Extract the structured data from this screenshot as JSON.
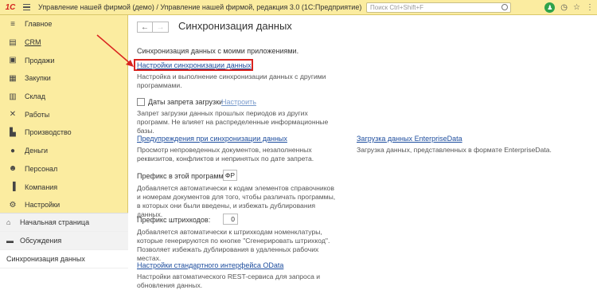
{
  "titlebar": {
    "logo": "1С",
    "title": "Управление нашей фирмой (демо) / Управление нашей фирмой, редакция 3.0  (1С:Предприятие)",
    "search_placeholder": "Поиск Ctrl+Shift+F"
  },
  "sidebar": {
    "items": [
      {
        "label": "Главное",
        "icon": "menu-lines-icon"
      },
      {
        "label": "CRM",
        "icon": "crm-icon"
      },
      {
        "label": "Продажи",
        "icon": "cart-icon"
      },
      {
        "label": "Закупки",
        "icon": "purchase-icon"
      },
      {
        "label": "Склад",
        "icon": "warehouse-icon"
      },
      {
        "label": "Работы",
        "icon": "hammer-icon"
      },
      {
        "label": "Производство",
        "icon": "factory-icon"
      },
      {
        "label": "Деньги",
        "icon": "money-icon"
      },
      {
        "label": "Персонал",
        "icon": "people-icon"
      },
      {
        "label": "Компания",
        "icon": "company-icon"
      },
      {
        "label": "Настройки",
        "icon": "gear-icon"
      }
    ],
    "open": [
      {
        "label": "Начальная страница",
        "icon": "home-icon"
      },
      {
        "label": "Обсуждения",
        "icon": "chat-icon"
      },
      {
        "label": "Синхронизация данных",
        "icon": ""
      }
    ]
  },
  "main": {
    "title": "Синхронизация данных",
    "section_label": "Синхронизация данных с моими приложениями.",
    "sync_settings_link": "Настройки синхронизации данных",
    "sync_settings_desc": "Настройка и выполнение синхронизации данных с другими программами.",
    "ban_dates_label": "Даты запрета загрузки",
    "ban_dates_setup": "Настроить",
    "ban_dates_desc": "Запрет загрузки данных прошлых периодов из других программ. Не влияет на распределенные информационные базы.",
    "warnings_link": "Предупреждения при синхронизации данных",
    "warnings_desc": "Просмотр непроведенных документов, незаполненных реквизитов, конфликтов и непринятых по дате запрета.",
    "enterprise_link": "Загрузка данных EnterpriseData",
    "enterprise_desc": "Загрузка данных, представленных в формате EnterpriseData.",
    "prefix_label": "Префикс в этой программе:",
    "prefix_value": "ФР",
    "prefix_desc": "Добавляется автоматически к кодам элементов справочников и номерам документов для того, чтобы различать программы, в которых они были введены, и избежать дублирования данных.",
    "barcode_label": "Префикс штрихкодов:",
    "barcode_value": "0",
    "barcode_desc": "Добавляется автоматически к штрихкодам номенклатуры, которые генерируются по кнопке \"Сгенерировать штрихкод\". Позволяет избежать дублирования в удаленных рабочих местах.",
    "odata_link": "Настройки стандартного интерфейса OData",
    "odata_desc": "Настройки автоматического REST-сервиса для запроса и обновления данных."
  }
}
